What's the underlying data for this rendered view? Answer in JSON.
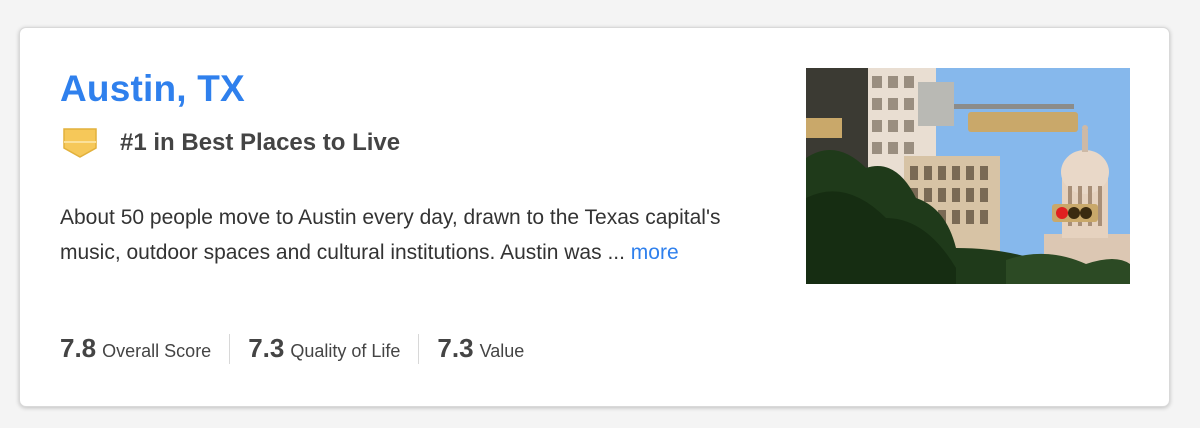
{
  "city": {
    "title": "Austin, TX",
    "rank_text": "#1 in Best Places to Live",
    "description": "About 50 people move to Austin every day, drawn to the Texas capital's music, outdoor spaces and cultural institutions. Austin was ...",
    "more_label": "more",
    "photo_icon": "austin-skyline-photo"
  },
  "scores": [
    {
      "value": "7.8",
      "label": "Overall Score"
    },
    {
      "value": "7.3",
      "label": "Quality of Life"
    },
    {
      "value": "7.3",
      "label": "Value"
    }
  ],
  "colors": {
    "accent": "#2f80ed",
    "text": "#444444",
    "badge": "#f6c859"
  }
}
